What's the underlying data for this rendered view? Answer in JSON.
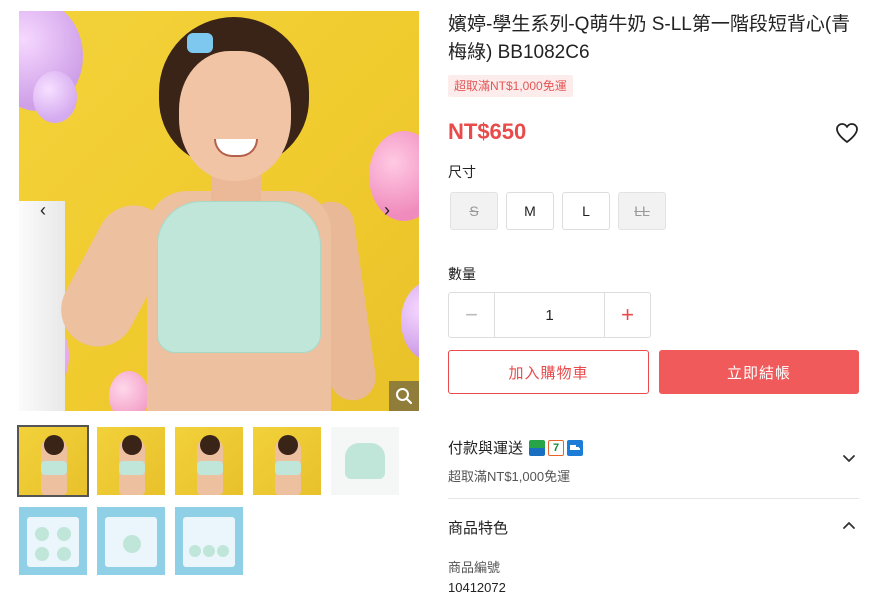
{
  "product": {
    "title": "嬪婷-學生系列-Q萌牛奶 S-LL第一階段短背心(青梅綠) BB1082C6",
    "promo_tag": "超取滿NT$1,000免運",
    "price": "NT$650"
  },
  "gallery": {
    "prev_icon": "chevron-left-icon",
    "next_icon": "chevron-right-icon",
    "zoom_icon": "magnifier-icon",
    "thumbnail_count": 8,
    "active_thumbnail": 1
  },
  "size": {
    "label": "尺寸",
    "options": [
      {
        "label": "S",
        "available": false
      },
      {
        "label": "M",
        "available": true
      },
      {
        "label": "L",
        "available": true
      },
      {
        "label": "LL",
        "available": false
      }
    ]
  },
  "quantity": {
    "label": "數量",
    "value": "1",
    "minus": "−",
    "plus": "+"
  },
  "actions": {
    "add_to_cart": "加入購物車",
    "buy_now": "立即結帳"
  },
  "payment": {
    "title": "付款與運送",
    "subtitle": "超取滿NT$1,000免運",
    "seven_glyph": "7"
  },
  "features": {
    "title": "商品特色",
    "code_label": "商品編號",
    "code_value": "10412072"
  },
  "colors": {
    "accent": "#e94b4b",
    "buy_button": "#f05a5a"
  }
}
